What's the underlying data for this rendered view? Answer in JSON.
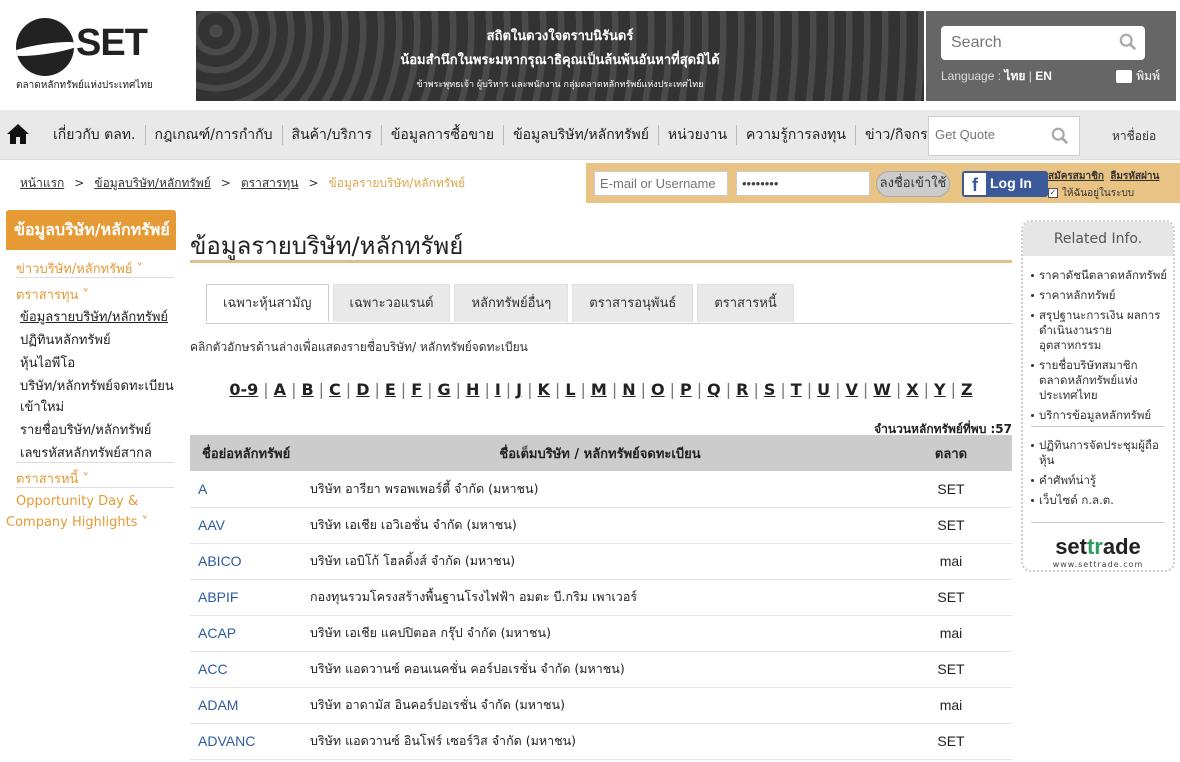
{
  "header": {
    "logo_text": "SET",
    "logo_sub": "ตลาดหลักทรัพย์แห่งประเทศไทย",
    "banner_line1": "สถิตในดวงใจตราบนิรันดร์",
    "banner_line2": "น้อมสำนึกในพระมหากรุณาธิคุณเป็นล้นพ้นอันหาที่สุดมิได้",
    "banner_line3": "ข้าพระพุทธเจ้า ผู้บริหาร และพนักงาน กลุ่มตลาดหลักทรัพย์แห่งประเทศไทย",
    "search_placeholder": "Search",
    "language_label": "Language :",
    "lang_th": "ไทย",
    "lang_sep": "|",
    "lang_en": "EN",
    "print_label": "พิมพ์"
  },
  "nav": {
    "items": [
      "เกี่ยวกับ ตลท.",
      "กฎเกณฑ์/การกำกับ",
      "สินค้า/บริการ",
      "ข้อมูลการซื้อขาย",
      "ข้อมูลบริษัท/หลักทรัพย์",
      "หน่วยงาน",
      "ความรู้การลงทุน",
      "ข่าว/กิจกรรม"
    ],
    "quote_placeholder": "Get Quote",
    "find_symbol": "หาชื่อย่อ"
  },
  "breadcrumb": {
    "items": [
      "หน้าแรก",
      "ข้อมูลบริษัท/หลักทรัพย์",
      "ตราสารทุน"
    ],
    "current": "ข้อมูลรายบริษัท/หลักทรัพย์",
    "sep": ">"
  },
  "login": {
    "email_placeholder": "E-mail or Username",
    "password_value": "••••••••",
    "login_button": "ลงชื่อเข้าใช้",
    "fb_letter": "f",
    "fb_login": "Log In",
    "register": "สมัครสมาชิก",
    "forgot": "ลืมรหัสผ่าน",
    "remember": "ให้ฉันอยู่ในระบบ",
    "remember_mark": "✓"
  },
  "leftnav": {
    "header": "ข้อมูลบริษัท/หลักทรัพย์",
    "sec_news": "ข่าวบริษัท/หลักทรัพย์ ˅",
    "sec_equity": "ตราสารทุน ˅",
    "equity_items": [
      "ข้อมูลรายบริษัท/หลักทรัพย์",
      "ปฏิทินหลักทรัพย์",
      "หุ้นไอพีโอ",
      "บริษัท/หลักทรัพย์จดทะเบียน",
      "เข้าใหม่",
      "รายชื่อบริษัท/หลักทรัพย์",
      "เลขรหัสหลักทรัพย์สากล"
    ],
    "sec_debt": "ตราสารหนี้ ˅",
    "sec_opp1": "Opportunity Day &",
    "sec_opp2": "Company Highlights ˅"
  },
  "main": {
    "title": "ข้อมูลรายบริษัท/หลักทรัพย์",
    "tabs": [
      "เฉพาะหุ้นสามัญ",
      "เฉพาะวอแรนต์",
      "หลักทรัพย์อื่นๆ",
      "ตราสารอนุพันธ์",
      "ตราสารหนี้"
    ],
    "instruction": "คลิกตัวอักษรด้านล่างเพื่อแสดงรายชื่อบริษัท/ หลักทรัพย์จดทะเบียน",
    "alphabet": [
      "0-9",
      "A",
      "B",
      "C",
      "D",
      "E",
      "F",
      "G",
      "H",
      "I",
      "J",
      "K",
      "L",
      "M",
      "N",
      "O",
      "P",
      "Q",
      "R",
      "S",
      "T",
      "U",
      "V",
      "W",
      "X",
      "Y",
      "Z"
    ],
    "alpha_sep": "|",
    "count_label": "จำนวนหลักทรัพย์ที่พบ :57",
    "table": {
      "headers": [
        "ชื่อย่อหลักทรัพย์",
        "ชื่อเต็มบริษัท / หลักทรัพย์จดทะเบียน",
        "ตลาด"
      ],
      "rows": [
        [
          "A",
          "บริษัท อารียา พรอพเพอร์ตี้ จำกัด (มหาชน)",
          "SET"
        ],
        [
          "AAV",
          "บริษัท เอเชีย เอวิเอชั่น จำกัด (มหาชน)",
          "SET"
        ],
        [
          "ABICO",
          "บริษัท เอบิโก้ โฮลดิ้งส์ จำกัด (มหาชน)",
          "mai"
        ],
        [
          "ABPIF",
          "กองทุนรวมโครงสร้างพื้นฐานโรงไฟฟ้า อมตะ บี.กริม เพาเวอร์",
          "SET"
        ],
        [
          "ACAP",
          "บริษัท เอเชีย แคปปิตอล กรุ๊ป จำกัด (มหาชน)",
          "mai"
        ],
        [
          "ACC",
          "บริษัท แอดวานซ์ คอนเนคชั่น คอร์ปอเรชั่น จำกัด (มหาชน)",
          "SET"
        ],
        [
          "ADAM",
          "บริษัท อาดามัส อินคอร์ปอเรชั่น จำกัด (มหาชน)",
          "mai"
        ],
        [
          "ADVANC",
          "บริษัท แอดวานซ์ อินโฟร์ เซอร์วิส จำกัด (มหาชน)",
          "SET"
        ]
      ]
    }
  },
  "related": {
    "title": "Related Info.",
    "group1": [
      "ราคาดัชนีตลาดหลักทรัพย์",
      "ราคาหลักทรัพย์",
      "สรุปฐานะการเงิน ผลการดำเนินงานรายอุตสาหกรรม",
      "รายชื่อบริษัทสมาชิก ตลาดหลักทรัพย์แห่งประเทศไทย",
      "บริการข้อมูลหลักทรัพย์"
    ],
    "group2": [
      "ปฏิทินการจัดประชุมผู้ถือหุ้น",
      "คำศัพท์น่ารู้",
      "เว็บไซต์ ก.ล.ต."
    ],
    "settrade_a": "set",
    "settrade_b": "tr",
    "settrade_c": "ade",
    "settrade_url": "www.settrade.com"
  }
}
